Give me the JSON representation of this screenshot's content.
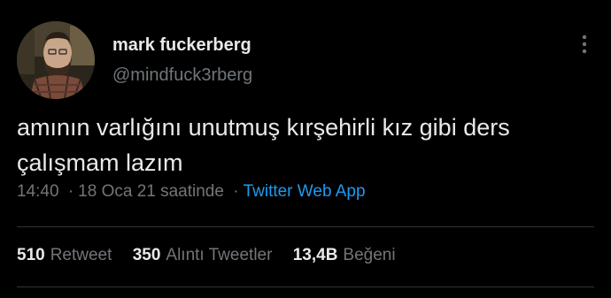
{
  "author": {
    "name": "mark fuckerberg",
    "handle": "@mindfuck3rberg"
  },
  "tweet": {
    "text": "amının varlığını unutmuş kırşehirli kız gibi ders çalışmam lazım",
    "time": "14:40",
    "separator": "·",
    "date": "18 Oca 21 saatinde",
    "source": "Twitter Web App"
  },
  "stats": {
    "retweets": {
      "count": "510",
      "label": "Retweet"
    },
    "quotes": {
      "count": "350",
      "label": "Alıntı Tweetler"
    },
    "likes": {
      "count": "13,4B",
      "label": "Beğeni"
    }
  },
  "icons": {
    "more": "more-vertical-icon"
  },
  "colors": {
    "background": "#000000",
    "text": "#e7e9ea",
    "muted": "#71767b",
    "link": "#1d9bf0"
  }
}
